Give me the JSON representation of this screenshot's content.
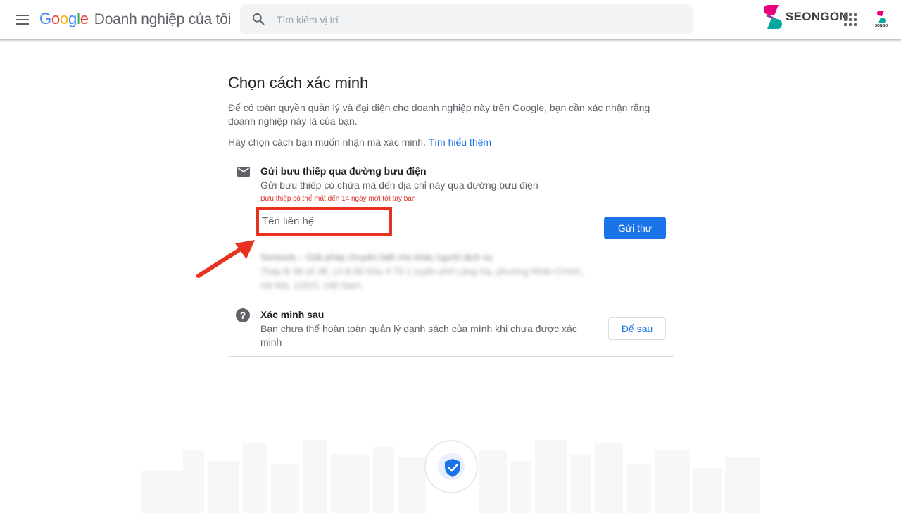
{
  "header": {
    "menu_icon": "menu-icon",
    "brand_google": [
      "G",
      "o",
      "o",
      "g",
      "l",
      "e"
    ],
    "brand_product": "Doanh nghiệp của tôi",
    "search_placeholder": "Tìm kiếm vị trí",
    "partner_logo_text": "SEONGON",
    "avatar_tag": "SONGO",
    "colors": {
      "blue": "#4285f4",
      "red": "#ea4335",
      "yellow": "#fbbc05",
      "green": "#34a853"
    }
  },
  "main": {
    "title": "Chọn cách xác minh",
    "description": "Để có toàn quyền quản lý và đại diện cho doanh nghiệp này trên Google, bạn cần xác nhận rằng doanh nghiệp này là của bạn.",
    "choose_text": "Hãy chọn cách bạn muốn nhận mã xác minh.",
    "learn_more": "Tìm hiểu thêm",
    "postcard": {
      "title": "Gửi bưu thiếp qua đường bưu điện",
      "subtitle": "Gửi bưu thiếp có chứa mã đến địa chỉ này qua đường bưu điện",
      "warning": "Bưu thiếp có thể mất đến 14 ngày mới tới tay bạn",
      "contact_placeholder": "Tên liên hệ",
      "send_button": "Gửi thư",
      "address_line1": "Seotools – Giải pháp chuyên biệt cho khác người dịch vụ",
      "address_line2": "Tháp B 38 số 38, Lô B 80 Khu 4 Tổ 1 tuyến phố Láng Hạ, phường Nhân Chính,",
      "address_line3": "Hà Nội, 11815, Việt Nam"
    },
    "later": {
      "title": "Xác minh sau",
      "subtitle": "Bạn chưa thể hoàn toàn quản lý danh sách của mình khi chưa được xác minh",
      "button": "Để sau"
    },
    "accent_color": "#1a73e8",
    "highlight_color": "#e8311e"
  }
}
